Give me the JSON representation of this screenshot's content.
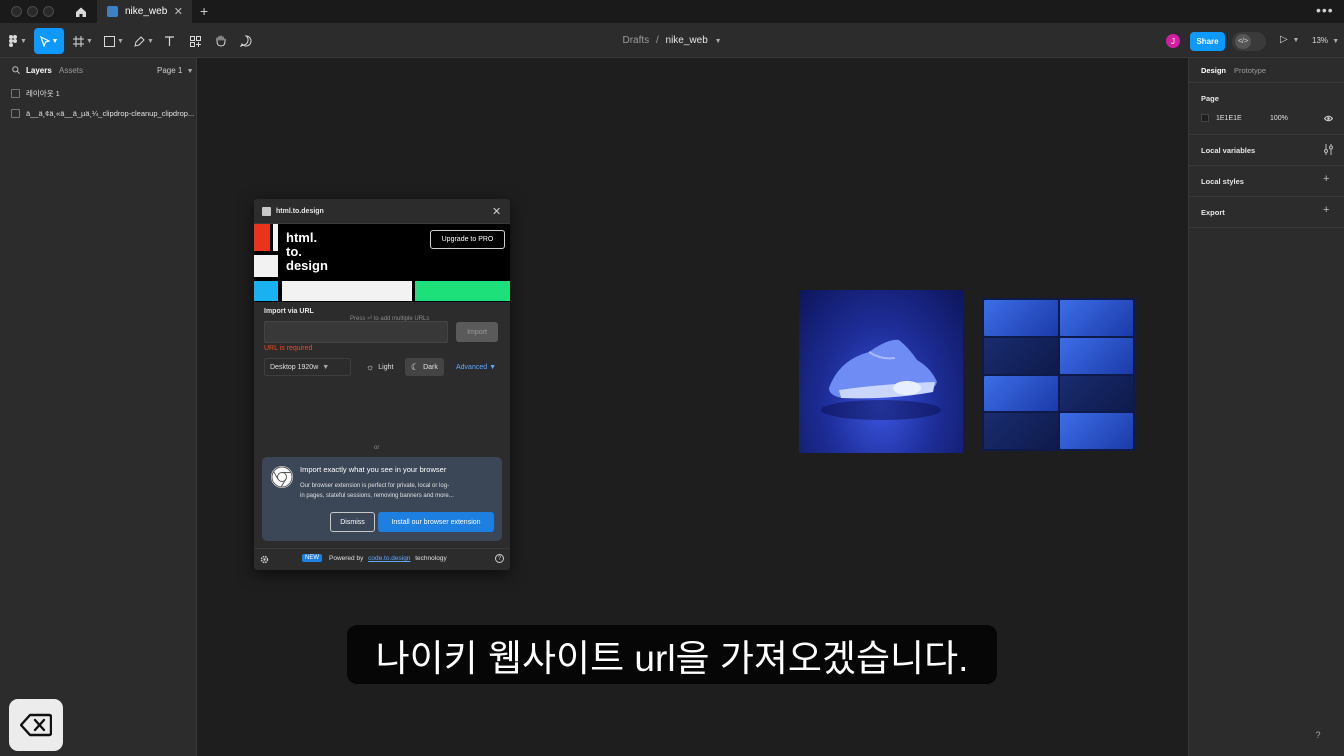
{
  "tabbar": {
    "file_tab_label": "nike_web",
    "close_glyph": "✕",
    "new_tab_glyph": "+",
    "more_glyph": "•••"
  },
  "toolbar": {
    "breadcrumb_project": "Drafts",
    "breadcrumb_separator": "/",
    "breadcrumb_file": "nike_web",
    "avatar_initial": "J",
    "share_label": "Share",
    "dev_mode_glyph": "</>",
    "play_glyph": "▷",
    "zoom_label": "13%"
  },
  "left_panel": {
    "tab_layers": "Layers",
    "tab_assets": "Assets",
    "page_selector": "Page 1",
    "layers": [
      {
        "name": "레이아웃 1"
      },
      {
        "name": "ä__ä¸¢ä¸«ä__ä_µä¸¼_clipdrop-cleanup_clipdrop..."
      }
    ]
  },
  "right_panel": {
    "tab_design": "Design",
    "tab_prototype": "Prototype",
    "page_heading": "Page",
    "page_color_hex": "1E1E1E",
    "page_opacity": "100%",
    "local_variables": "Local variables",
    "local_styles": "Local styles",
    "export": "Export"
  },
  "plugin": {
    "title": "html.to.design",
    "logo_lines": [
      "html.",
      "to.",
      "design"
    ],
    "upgrade_label": "Upgrade to PRO",
    "import_heading": "Import via URL",
    "hint": "Press ⏎ to add multiple URLs",
    "url_placeholder": "",
    "import_label": "Import",
    "error": "URL is required",
    "device": "Desktop 1920w",
    "light_label": "Light",
    "dark_label": "Dark",
    "advanced_label": "Advanced",
    "or_label": "or",
    "ext_title": "Import exactly what you see in your browser",
    "ext_body_line1": "Our browser extension is perfect for private, local or log-",
    "ext_body_line2": "in pages, stateful sessions, removing banners and more...",
    "dismiss_label": "Dismiss",
    "install_label": "Install our browser extension",
    "new_badge": "NEW",
    "powered_by": "Powered by",
    "powered_link": "code.to.design",
    "powered_suffix": "technology",
    "help_glyph": "?"
  },
  "subtitle": "나이키 웹사이트 url을 가져오겠습니다.",
  "help_glyph": "?",
  "colors": {
    "accent": "#0d99ff",
    "canvas": "#1e1e1e",
    "panel": "#2c2c2c",
    "error": "#f24822",
    "link": "#5fa8ff"
  }
}
